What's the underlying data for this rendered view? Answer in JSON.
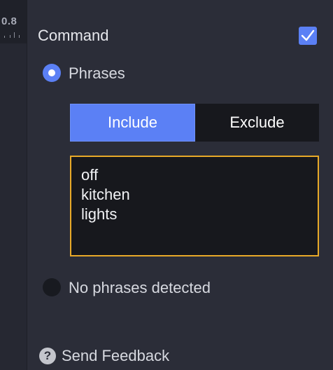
{
  "left_strip": {
    "zoom_value": "0.8"
  },
  "command": {
    "label": "Command",
    "checked": true
  },
  "phrases_option": {
    "label": "Phrases",
    "selected": true
  },
  "mode_tabs": [
    {
      "label": "Include",
      "active": true
    },
    {
      "label": "Exclude",
      "active": false
    }
  ],
  "phrases": [
    "off",
    "kitchen",
    "lights"
  ],
  "no_phrases_option": {
    "label": "No phrases detected",
    "selected": false
  },
  "feedback": {
    "icon": "question-icon",
    "label": "Send Feedback"
  },
  "colors": {
    "accent": "#5b80f5",
    "focus_border": "#e8a928",
    "background": "#2b2d38"
  }
}
